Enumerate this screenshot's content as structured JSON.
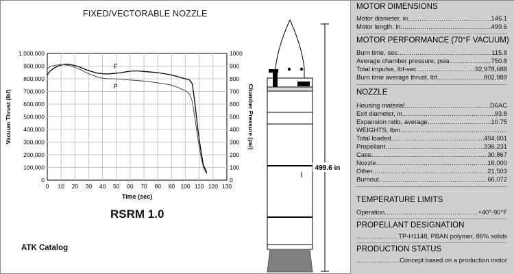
{
  "chart_title": "FIXED/VECTORABLE NOZZLE",
  "chart_data": {
    "type": "line",
    "xlabel": "Time (sec)",
    "ylabel_left": "Vacuum Thrust (lbf)",
    "ylabel_right": "Chamber Pressure (psi)",
    "xlim": [
      0,
      130
    ],
    "ylim_left": [
      0,
      1000000
    ],
    "ylim_right": [
      0,
      1000
    ],
    "x_ticks": [
      "0",
      "10",
      "20",
      "30",
      "40",
      "50",
      "60",
      "70",
      "80",
      "90",
      "100",
      "110",
      "120",
      "130"
    ],
    "y_left_ticks": [
      "0",
      "100,000",
      "200,000",
      "300,000",
      "400,000",
      "500,000",
      "600,000",
      "700,000",
      "800,000",
      "900,000",
      "1,000,000"
    ],
    "y_right_ticks": [
      "0",
      "100",
      "200",
      "300",
      "400",
      "500",
      "600",
      "700",
      "800",
      "900",
      "1000"
    ],
    "grid": true,
    "series": [
      {
        "name": "F",
        "axis": "left",
        "x": [
          0,
          2,
          5,
          8,
          10,
          13,
          16,
          20,
          24,
          28,
          32,
          36,
          40,
          44,
          48,
          52,
          56,
          60,
          65,
          70,
          75,
          80,
          85,
          90,
          95,
          100,
          103,
          105,
          107,
          109,
          111,
          113,
          115.5
        ],
        "y": [
          830000,
          860000,
          885000,
          900000,
          908000,
          915000,
          913000,
          905000,
          890000,
          872000,
          858000,
          845000,
          840000,
          838000,
          842000,
          846000,
          853000,
          860000,
          862000,
          858000,
          853000,
          848000,
          840000,
          830000,
          815000,
          800000,
          790000,
          760000,
          600000,
          400000,
          250000,
          120000,
          60000
        ]
      },
      {
        "name": "P",
        "axis": "right",
        "x": [
          0,
          2,
          5,
          8,
          10,
          13,
          16,
          20,
          24,
          28,
          32,
          36,
          40,
          44,
          48,
          52,
          56,
          60,
          65,
          70,
          75,
          80,
          85,
          90,
          95,
          100,
          103,
          105,
          107,
          109,
          111,
          113,
          115.5
        ],
        "y": [
          880,
          895,
          905,
          910,
          912,
          910,
          905,
          890,
          872,
          850,
          830,
          815,
          805,
          800,
          800,
          798,
          795,
          790,
          786,
          782,
          775,
          768,
          760,
          750,
          730,
          705,
          680,
          620,
          480,
          330,
          200,
          100,
          50
        ]
      }
    ]
  },
  "rsrm_title": "RSRM 1.0",
  "catalog_label": "ATK Catalog",
  "rocket_length_label": "499.6 in",
  "specs": {
    "motor_dimensions": {
      "title": "MOTOR DIMENSIONS",
      "rows": [
        {
          "label": "Motor diameter, in.",
          "value": "146.1"
        },
        {
          "label": "Motor length, in.",
          "value": "499.6"
        }
      ]
    },
    "motor_performance": {
      "title": "MOTOR PERFORMANCE (70°F VACUUM)",
      "rows": [
        {
          "label": "Burn time, sec",
          "value": "115.8"
        },
        {
          "label": "Average chamber pressure, psia",
          "value": "750.8"
        },
        {
          "label": "Total impulse, lbf-sec",
          "value": "92,978,688"
        },
        {
          "label": "Burn time average thrust, lbf",
          "value": "802,989"
        }
      ]
    },
    "nozzle": {
      "title": "NOZZLE",
      "rows": [
        {
          "label": "Housing material",
          "value": "D6AC"
        },
        {
          "label": "Exit diameter, in.",
          "value": "93.8"
        },
        {
          "label": "Expansion ratio, average",
          "value": "10.75"
        }
      ]
    },
    "weights": {
      "title": "WEIGHTS, lbm",
      "rows": [
        {
          "label": "Total loaded",
          "value": "404,601"
        },
        {
          "label": "Propellant",
          "value": "336,231"
        },
        {
          "label": "Case",
          "value": "30,867"
        },
        {
          "label": "Nozzle",
          "value": "16,000"
        },
        {
          "label": "Other",
          "value": "21,503"
        },
        {
          "label": "Burnout",
          "value": "66,072"
        }
      ]
    },
    "temperature_limits": {
      "title": "TEMPERATURE LIMITS",
      "rows": [
        {
          "label": "Operation",
          "value": "+40°-90°F"
        }
      ]
    },
    "propellant_designation": {
      "title": "PROPELLANT DESIGNATION",
      "value": "TP-H1148, PBAN polymer, 86% solids"
    },
    "production_status": {
      "title": "PRODUCTION STATUS",
      "value": "Concept based on a production motor"
    }
  },
  "colors": {
    "panel_bg": "#cfcfcf",
    "nozzle_bell": "#7f7f7f",
    "rocket_body": "#ffffff",
    "ink": "#000000"
  }
}
